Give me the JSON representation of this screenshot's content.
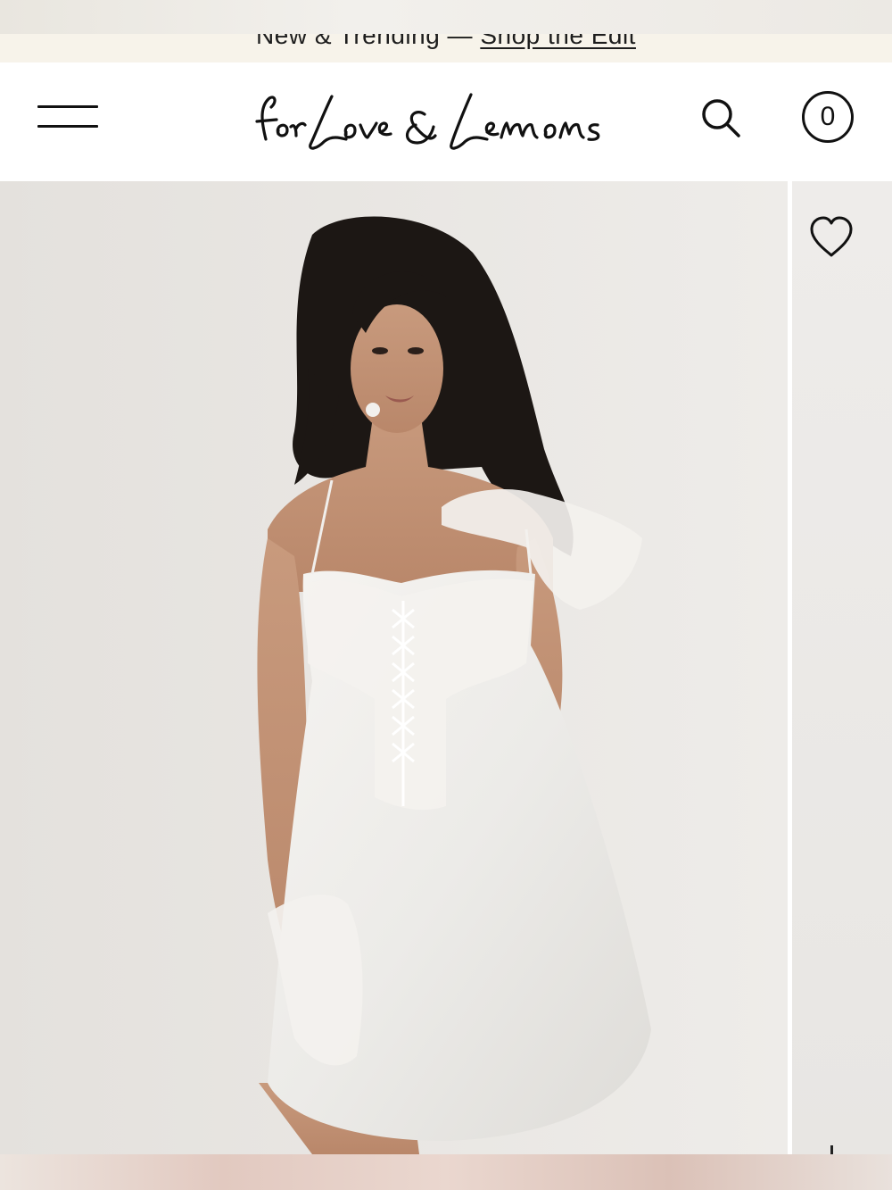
{
  "announcement": {
    "text": "New & Trending — ",
    "link_label": "Shop the Edit"
  },
  "header": {
    "logo_text": "for Love & Lemons",
    "menu_icon": "hamburger-icon",
    "search_icon": "search-icon",
    "cart_count": "0"
  },
  "product": {
    "image_alt": "Model wearing white lace-up satin slip dress with lace gloves",
    "wishlist_icon": "heart-icon"
  },
  "colors": {
    "announcement_bg": "#f7f3ea",
    "text": "#111111",
    "photo_bg": "#e8e5e1"
  }
}
